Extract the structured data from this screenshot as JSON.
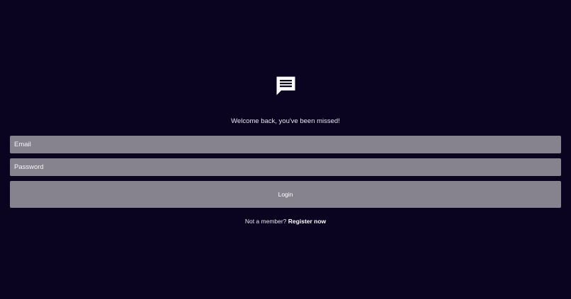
{
  "logo": {
    "icon": "chat-message-icon"
  },
  "welcome_text": "Welcome back, you've been missed!",
  "form": {
    "email_placeholder": "Email",
    "email_value": "",
    "password_placeholder": "Password",
    "password_value": "",
    "login_label": "Login"
  },
  "register": {
    "prompt": "Not a member?",
    "link_label": "Register now"
  },
  "colors": {
    "background": "#0b0421",
    "field": "#86838f",
    "text": "#ffffff"
  }
}
